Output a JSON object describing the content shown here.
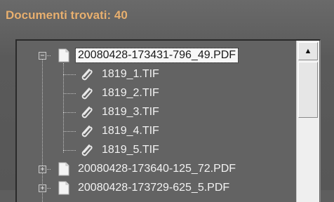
{
  "header": {
    "title": "Documenti trovati: 40"
  },
  "tree": {
    "nodes": [
      {
        "label": "20080428-173431-796_49.PDF",
        "expander": "−",
        "children": [
          {
            "label": "1819_1.TIF"
          },
          {
            "label": "1819_2.TIF"
          },
          {
            "label": "1819_3.TIF"
          },
          {
            "label": "1819_4.TIF"
          },
          {
            "label": "1819_5.TIF"
          }
        ]
      },
      {
        "label": "20080428-173640-125_72.PDF",
        "expander": "+"
      },
      {
        "label": "20080428-173729-625_5.PDF",
        "expander": "+"
      }
    ]
  },
  "scrollbar": {
    "up_glyph": "▲"
  },
  "colors": {
    "title": "#e8b070",
    "background": "#5e5e5e",
    "panel": "#636363"
  }
}
